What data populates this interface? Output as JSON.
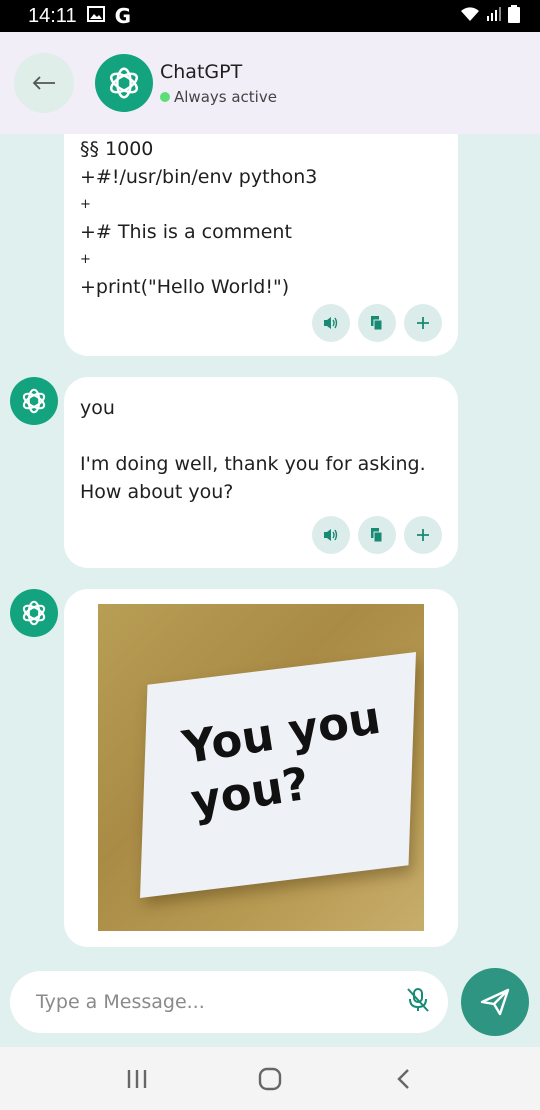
{
  "status_bar": {
    "time": "14:11",
    "icons": [
      "gallery-icon",
      "google-icon",
      "wifi-icon",
      "signal-icon",
      "battery-icon"
    ]
  },
  "header": {
    "bot_name": "ChatGPT",
    "bot_status": "Always active",
    "status_color": "#5ddc78",
    "accent": "#14a37f"
  },
  "messages": [
    {
      "lines": [
        "§§ 1000",
        "+#!/usr/bin/env python3",
        "+",
        "+# This is a comment",
        "+",
        "+print(\"Hello World!\")"
      ],
      "actions": [
        "speaker-icon",
        "copy-icon",
        "add-icon"
      ]
    },
    {
      "text": "you\n\nI'm doing well, thank you for asking.\nHow about you?",
      "actions": [
        "speaker-icon",
        "copy-icon",
        "add-icon"
      ]
    },
    {
      "image_text": "You you you?"
    }
  ],
  "input": {
    "placeholder": "Type a Message..."
  },
  "nav": [
    "recents-icon",
    "home-icon",
    "back-nav-icon"
  ]
}
